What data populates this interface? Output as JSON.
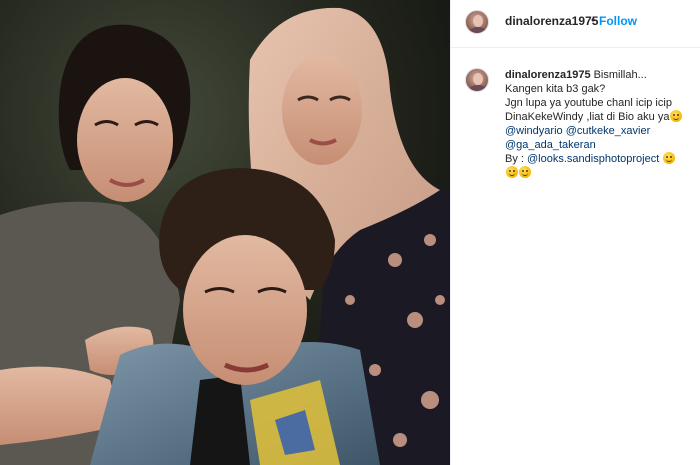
{
  "post": {
    "username": "dinalorenza1975",
    "separator": "•",
    "follow_label": "Follow"
  },
  "caption": {
    "username": "dinalorenza1975",
    "line1": "Bismillah...",
    "line2": "Kangen kita b3 gak?",
    "line3": "Jgn lupa ya youtube chanl icip icip",
    "line4": "DinaKekeWindy ,liat di Bio aku ya",
    "mention1": "@windyario",
    "mention2": "@cutkeke_xavier",
    "mention3": "@ga_ada_takeran",
    "by_prefix": "By : ",
    "mention4": "@looks.sandisphotoproject",
    "emoji_name": "smiling-face-emoji"
  }
}
